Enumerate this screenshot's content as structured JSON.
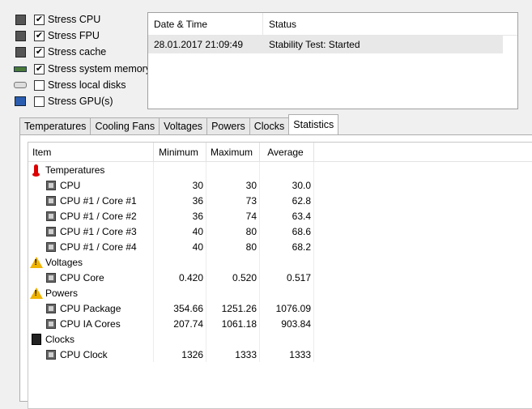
{
  "options": [
    {
      "label": "Stress CPU",
      "checked": true,
      "icon": "cpu-icon"
    },
    {
      "label": "Stress FPU",
      "checked": true,
      "icon": "fpu-icon"
    },
    {
      "label": "Stress cache",
      "checked": true,
      "icon": "cache-icon"
    },
    {
      "label": "Stress system memory",
      "checked": true,
      "icon": "memory-icon"
    },
    {
      "label": "Stress local disks",
      "checked": false,
      "icon": "disk-icon"
    },
    {
      "label": "Stress GPU(s)",
      "checked": false,
      "icon": "gpu-icon"
    }
  ],
  "status_log": {
    "headers": {
      "date": "Date & Time",
      "status": "Status"
    },
    "rows": [
      {
        "date": "28.01.2017 21:09:49",
        "status": "Stability Test: Started"
      }
    ]
  },
  "tabs": [
    "Temperatures",
    "Cooling Fans",
    "Voltages",
    "Powers",
    "Clocks",
    "Statistics"
  ],
  "active_tab": "Statistics",
  "statistics": {
    "headers": {
      "item": "Item",
      "min": "Minimum",
      "max": "Maximum",
      "avg": "Average"
    },
    "rows": [
      {
        "type": "group",
        "icon": "thermometer-icon",
        "label": "Temperatures"
      },
      {
        "type": "item",
        "label": "CPU",
        "min": "30",
        "max": "30",
        "avg": "30.0"
      },
      {
        "type": "item",
        "label": "CPU #1 / Core #1",
        "min": "36",
        "max": "73",
        "avg": "62.8"
      },
      {
        "type": "item",
        "label": "CPU #1 / Core #2",
        "min": "36",
        "max": "74",
        "avg": "63.4"
      },
      {
        "type": "item",
        "label": "CPU #1 / Core #3",
        "min": "40",
        "max": "80",
        "avg": "68.6"
      },
      {
        "type": "item",
        "label": "CPU #1 / Core #4",
        "min": "40",
        "max": "80",
        "avg": "68.2"
      },
      {
        "type": "group",
        "icon": "warning-icon",
        "label": "Voltages"
      },
      {
        "type": "item",
        "label": "CPU Core",
        "min": "0.420",
        "max": "0.520",
        "avg": "0.517"
      },
      {
        "type": "group",
        "icon": "warning-icon",
        "label": "Powers"
      },
      {
        "type": "item",
        "label": "CPU Package",
        "min": "354.66",
        "max": "1251.26",
        "avg": "1076.09"
      },
      {
        "type": "item",
        "label": "CPU IA Cores",
        "min": "207.74",
        "max": "1061.18",
        "avg": "903.84"
      },
      {
        "type": "group",
        "icon": "clock-icon",
        "label": "Clocks"
      },
      {
        "type": "item",
        "label": "CPU Clock",
        "min": "1326",
        "max": "1333",
        "avg": "1333"
      }
    ]
  }
}
